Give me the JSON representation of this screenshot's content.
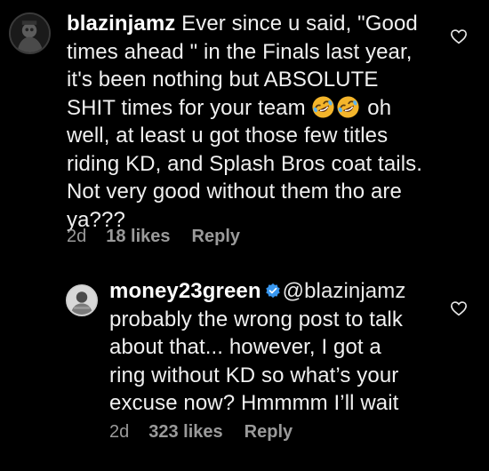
{
  "comments": [
    {
      "username": "blazinjamz",
      "text_lines": [
        "Ever since u said, \"Good",
        "times ahead \" in the Finals last year,",
        "it's been nothing but ABSOLUTE",
        "SHIT times for your team",
        "oh",
        "well,  at least u got those few titles",
        "riding KD, and Splash Bros coat tails.",
        "Not very good without them tho are",
        "ya???"
      ],
      "emojis": [
        "rofl-emoji",
        "rofl-emoji"
      ],
      "age": "2d",
      "likes": "18 likes",
      "reply_label": "Reply"
    },
    {
      "username": "money23green",
      "verified": true,
      "mention": "@blazinjamz",
      "text_lines": [
        "probably the wrong post to talk",
        "about that... however, I got a",
        "ring without KD so what’s your",
        "excuse now? Hmmmm I’ll wait"
      ],
      "age": "2d",
      "likes": "323 likes",
      "reply_label": "Reply"
    }
  ],
  "icons": {
    "like": "heart-outline-icon",
    "verified": "verified-badge-icon"
  },
  "colors": {
    "background": "#000000",
    "text": "#f0f0f0",
    "meta": "#9a9a9a",
    "verified_blue": "#3897f0"
  }
}
